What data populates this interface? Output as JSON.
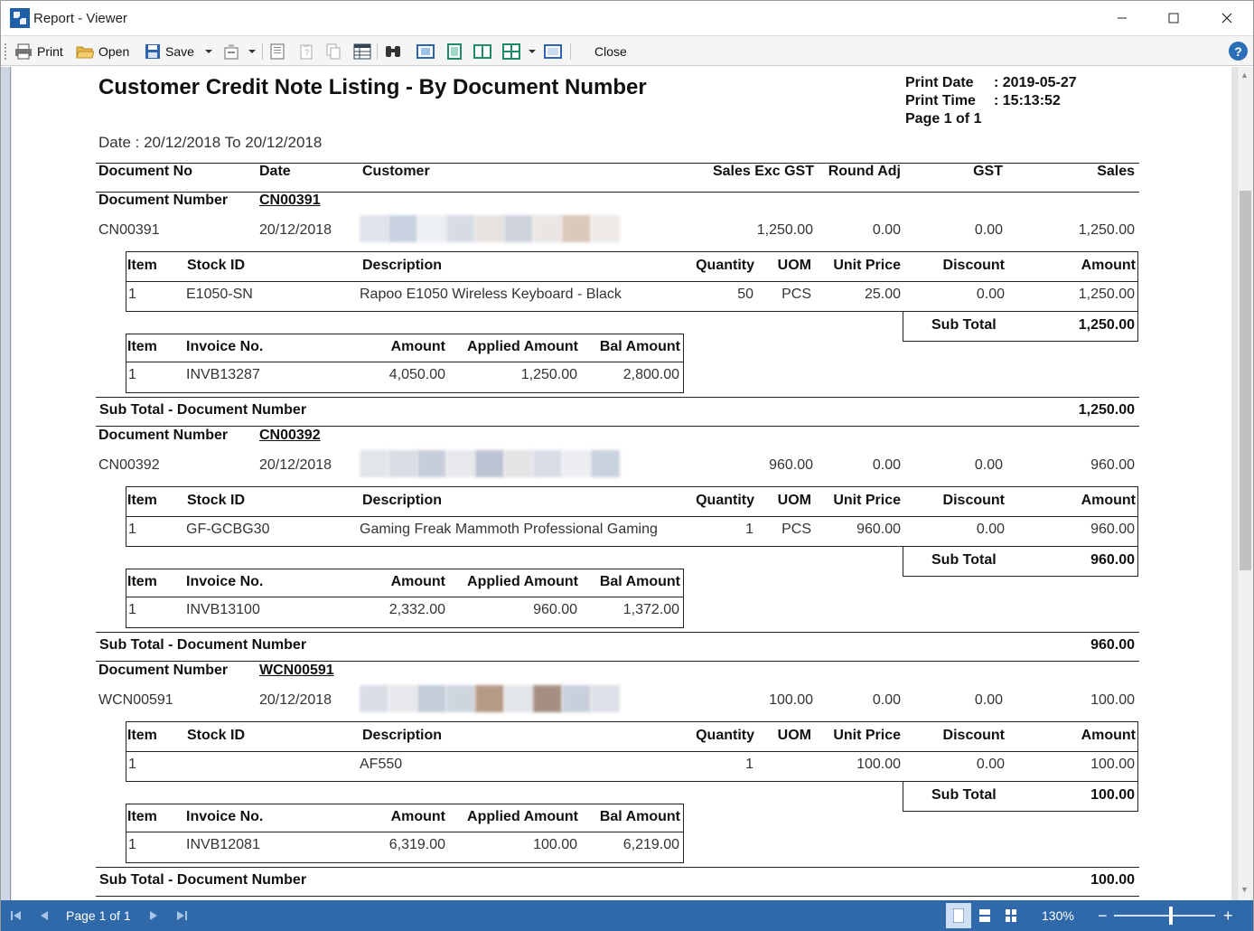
{
  "window": {
    "title": "Report - Viewer"
  },
  "toolbar": {
    "print_label": "Print",
    "open_label": "Open",
    "save_label": "Save",
    "close_label": "Close"
  },
  "report": {
    "title": "Customer Credit Note Listing - By Document Number",
    "print_date_label": "Print Date",
    "print_date_value": ": 2019-05-27",
    "print_time_label": "Print Time",
    "print_time_value": ": 15:13:52",
    "page_info": "Page 1 of 1",
    "date_range": "Date : 20/12/2018 To 20/12/2018",
    "columns": {
      "doc_no": "Document No",
      "date": "Date",
      "customer": "Customer",
      "sales_exc_gst": "Sales Exc GST",
      "round_adj": "Round Adj",
      "gst": "GST",
      "sales": "Sales"
    },
    "group_label": "Document Number",
    "item_headers": {
      "item": "Item",
      "stock_id": "Stock ID",
      "description": "Description",
      "quantity": "Quantity",
      "uom": "UOM",
      "unit_price": "Unit Price",
      "discount": "Discount",
      "amount": "Amount"
    },
    "sub_total_label": "Sub Total",
    "invoice_headers": {
      "item": "Item",
      "invoice_no": "Invoice No.",
      "amount": "Amount",
      "applied_amount": "Applied Amount",
      "bal_amount": "Bal Amount"
    },
    "doc_sub_total_label": "Sub Total - Document Number",
    "documents": [
      {
        "group_value": "CN00391",
        "doc_no": "CN00391",
        "date": "20/12/2018",
        "sales_exc_gst": "1,250.00",
        "round_adj": "0.00",
        "gst": "0.00",
        "sales": "1,250.00",
        "item": {
          "no": "1",
          "stock_id": "E1050-SN",
          "description": "Rapoo E1050 Wireless Keyboard - Black",
          "quantity": "50",
          "uom": "PCS",
          "unit_price": "25.00",
          "discount": "0.00",
          "amount": "1,250.00"
        },
        "item_sub_total": "1,250.00",
        "invoice": {
          "no": "1",
          "invoice_no": "INVB13287",
          "amount": "4,050.00",
          "applied_amount": "1,250.00",
          "bal_amount": "2,800.00"
        },
        "doc_sub_total": "1,250.00"
      },
      {
        "group_value": "CN00392",
        "doc_no": "CN00392",
        "date": "20/12/2018",
        "sales_exc_gst": "960.00",
        "round_adj": "0.00",
        "gst": "0.00",
        "sales": "960.00",
        "item": {
          "no": "1",
          "stock_id": "GF-GCBG30",
          "description": "Gaming Freak Mammoth Professional Gaming",
          "quantity": "1",
          "uom": "PCS",
          "unit_price": "960.00",
          "discount": "0.00",
          "amount": "960.00"
        },
        "item_sub_total": "960.00",
        "invoice": {
          "no": "1",
          "invoice_no": "INVB13100",
          "amount": "2,332.00",
          "applied_amount": "960.00",
          "bal_amount": "1,372.00"
        },
        "doc_sub_total": "960.00"
      },
      {
        "group_value": "WCN00591",
        "doc_no": "WCN00591",
        "date": "20/12/2018",
        "sales_exc_gst": "100.00",
        "round_adj": "0.00",
        "gst": "0.00",
        "sales": "100.00",
        "item": {
          "no": "1",
          "stock_id": "",
          "description": "AF550",
          "quantity": "1",
          "uom": "",
          "unit_price": "100.00",
          "discount": "0.00",
          "amount": "100.00"
        },
        "item_sub_total": "100.00",
        "invoice": {
          "no": "1",
          "invoice_no": "INVB12081",
          "amount": "6,319.00",
          "applied_amount": "100.00",
          "bal_amount": "6,219.00"
        },
        "doc_sub_total": "100.00"
      }
    ]
  },
  "status": {
    "page_text": "Page 1 of 1",
    "zoom": "130%"
  },
  "colors": {
    "statusbar": "#2f69a9",
    "accent": "#2b6fb6"
  }
}
